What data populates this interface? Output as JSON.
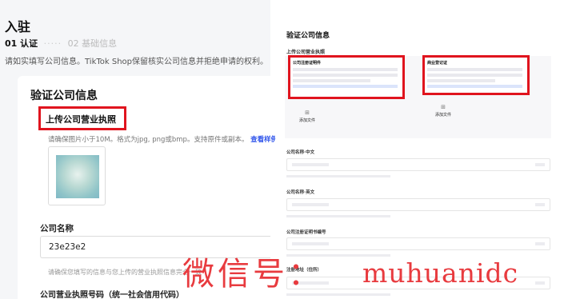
{
  "left": {
    "title": "入驻",
    "steps": {
      "step1": "01 认证",
      "dots": "·····",
      "step2": "02 基础信息"
    },
    "hint": "请如实填写公司信息。TikTok Shop保留核实公司信息并拒绝申请的权利。",
    "card": {
      "title": "验证公司信息",
      "upload_label": "上传公司营业执照",
      "upload_hint": "请确保图片小于10M。格式为jpg, png或bmp。支持原件或副本。",
      "upload_hint_link": "查看样例",
      "company_name_label": "公司名称",
      "company_name_value": "23e23e2",
      "company_name_hint": "请确保您填写的信息与您上传的营业执照信息完全一致",
      "license_number_label": "公司营业执照号码（统一社会信用代码）"
    }
  },
  "right": {
    "title": "验证公司信息",
    "upload_title": "上传公司营业执照",
    "box1_title": "公司注册证明件",
    "box2_title": "商业登记证",
    "add_file_label": "添加文件",
    "fields": {
      "chinese_name": "公司名称·中文",
      "english_name": "公司名称·英文",
      "registration_number": "公司注册证明书编号",
      "address": "注册地址（住所）"
    }
  },
  "watermark": {
    "cn": "微信号：",
    "latin": "muhuanidc"
  },
  "colors": {
    "highlight": "#e0141e",
    "link": "#2f54eb",
    "watermark": "#e83b3f"
  }
}
